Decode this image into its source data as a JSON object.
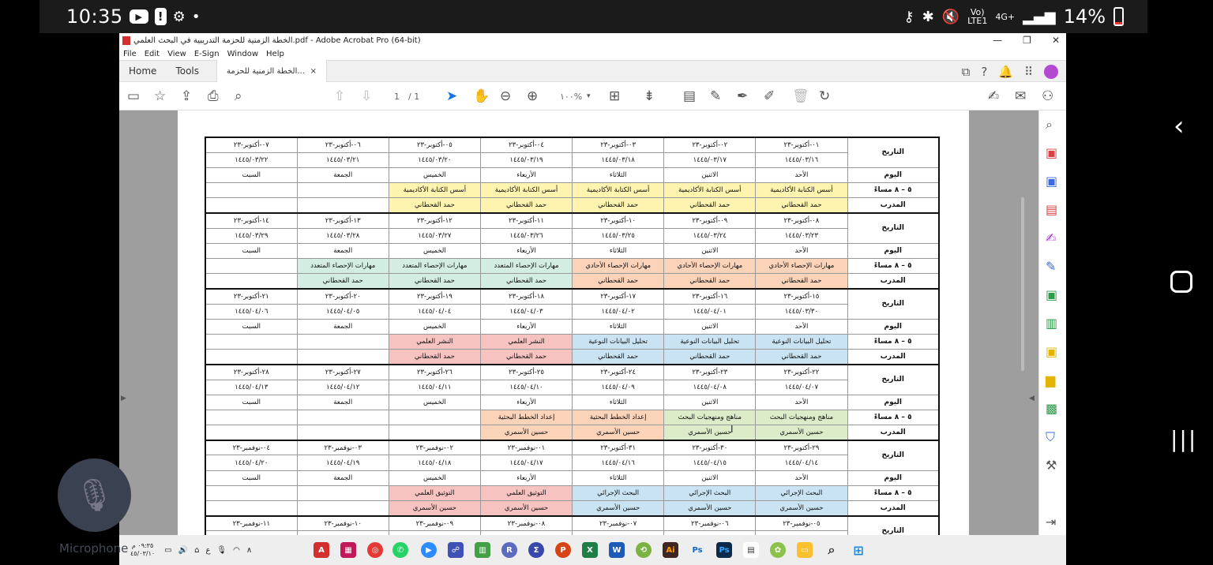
{
  "status_bar": {
    "time": "10:35",
    "net_top": "Vo)",
    "net_bottom": "LTE1",
    "net_type": "4G+",
    "battery_text": "14%",
    "battery_level": 0.14
  },
  "window": {
    "title": "الخطة الزمنية للحزمة التدريبية في البحث العلمي.pdf - Adobe Acrobat Pro (64-bit)"
  },
  "menu": [
    "File",
    "Edit",
    "View",
    "E-Sign",
    "Window",
    "Help"
  ],
  "tabs": {
    "home": "Home",
    "tools": "Tools",
    "doc": "الخطة الزمنية للحزمة...",
    "close": "×"
  },
  "toolbar": {
    "page_current": "1",
    "page_total": "/ 1",
    "zoom": "١٠٠%"
  },
  "schedule": {
    "labels": {
      "date": "التاريخ",
      "day": "اليوم",
      "time": "٥ – ٨ مساءً",
      "trainer": "المدرب"
    },
    "days": [
      "الأحد",
      "الاثنين",
      "الثلاثاء",
      "الأربعاء",
      "الخميس",
      "الجمعة",
      "السبت"
    ],
    "weeks": [
      {
        "greg": [
          "٠١-أكتوبر-٢٣",
          "٠٢-أكتوبر-٢٣",
          "٠٣-أكتوبر-٢٣",
          "٠٤-أكتوبر-٢٣",
          "٠٥-أكتوبر-٢٣",
          "٠٦-أكتوبر-٢٣",
          "٠٧-أكتوبر-٢٣"
        ],
        "hijri": [
          "١٤٤٥/٠٣/١٦",
          "١٤٤٥/٠٣/١٧",
          "١٤٤٥/٠٣/١٨",
          "١٤٤٥/٠٣/١٩",
          "١٤٤٥/٠٣/٢٠",
          "١٤٤٥/٠٣/٢١",
          "١٤٤٥/٠٣/٢٢"
        ],
        "topic": [
          "أسس الكتابة الأكاديمية",
          "أسس الكتابة الأكاديمية",
          "أسس الكتابة الأكاديمية",
          "أسس الكتابة الأكاديمية",
          "أسس الكتابة الأكاديمية",
          "",
          ""
        ],
        "trainer": [
          "حمد القحطاني",
          "حمد القحطاني",
          "حمد القحطاني",
          "حمد القحطاني",
          "حمد القحطاني",
          "",
          ""
        ],
        "colors": [
          "y",
          "y",
          "y",
          "y",
          "y",
          "",
          ""
        ]
      },
      {
        "greg": [
          "٠٨-أكتوبر-٢٣",
          "٠٩-أكتوبر-٢٣",
          "١٠-أكتوبر-٢٣",
          "١١-أكتوبر-٢٣",
          "١٢-أكتوبر-٢٣",
          "١٣-أكتوبر-٢٣",
          "١٤-أكتوبر-٢٣"
        ],
        "hijri": [
          "١٤٤٥/٠٣/٢٣",
          "١٤٤٥/٠٣/٢٤",
          "١٤٤٥/٠٣/٢٥",
          "١٤٤٥/٠٣/٢٦",
          "١٤٤٥/٠٣/٢٧",
          "١٤٤٥/٠٣/٢٨",
          "١٤٤٥/٠٣/٢٩"
        ],
        "topic": [
          "مهارات الإحصاء الأحادي",
          "مهارات الإحصاء الأحادي",
          "مهارات الإحصاء الأحادي",
          "مهارات الإحصاء المتعدد",
          "مهارات الإحصاء المتعدد",
          "مهارات الإحصاء المتعدد",
          ""
        ],
        "trainer": [
          "حمد القحطاني",
          "حمد القحطاني",
          "حمد القحطاني",
          "حمد القحطاني",
          "حمد القحطاني",
          "حمد القحطاني",
          ""
        ],
        "colors": [
          "o",
          "o",
          "o",
          "t",
          "t",
          "t",
          ""
        ]
      },
      {
        "greg": [
          "١٥-أكتوبر-٢٣",
          "١٦-أكتوبر-٢٣",
          "١٧-أكتوبر-٢٣",
          "١٨-أكتوبر-٢٣",
          "١٩-أكتوبر-٢٣",
          "٢٠-أكتوبر-٢٣",
          "٢١-أكتوبر-٢٣"
        ],
        "hijri": [
          "١٤٤٥/٠٣/٣٠",
          "١٤٤٥/٠٤/٠١",
          "١٤٤٥/٠٤/٠٢",
          "١٤٤٥/٠٤/٠٣",
          "١٤٤٥/٠٤/٠٤",
          "١٤٤٥/٠٤/٠٥",
          "١٤٤٥/٠٤/٠٦"
        ],
        "topic": [
          "تحليل البيانات النوعية",
          "تحليل البيانات النوعية",
          "تحليل البيانات النوعية",
          "النشر العلمي",
          "النشر العلمي",
          "",
          ""
        ],
        "trainer": [
          "حمد القحطاني",
          "حمد القحطاني",
          "حمد القحطاني",
          "حمد القحطاني",
          "حمد القحطاني",
          "",
          ""
        ],
        "colors": [
          "b",
          "b",
          "b",
          "r",
          "r",
          "",
          ""
        ]
      },
      {
        "greg": [
          "٢٢-أكتوبر-٢٣",
          "٢٣-أكتوبر-٢٣",
          "٢٤-أكتوبر-٢٣",
          "٢٥-أكتوبر-٢٣",
          "٢٦-أكتوبر-٢٣",
          "٢٧-أكتوبر-٢٣",
          "٢٨-أكتوبر-٢٣"
        ],
        "hijri": [
          "١٤٤٥/٠٤/٠٧",
          "١٤٤٥/٠٤/٠٨",
          "١٤٤٥/٠٤/٠٩",
          "١٤٤٥/٠٤/١٠",
          "١٤٤٥/٠٤/١١",
          "١٤٤٥/٠٤/١٢",
          "١٤٤٥/٠٤/١٣"
        ],
        "topic": [
          "مناهج ومنهجيات البحث",
          "مناهج ومنهجيات البحث",
          "إعداد الخطط البحثية",
          "إعداد الخطط البحثية",
          "",
          "",
          ""
        ],
        "trainer": [
          "حسين الأسمري",
          "حسين الأسمري",
          "حسين الأسمري",
          "حسين الأسمري",
          "",
          "",
          ""
        ],
        "colors": [
          "g",
          "g",
          "o",
          "o",
          "",
          "",
          ""
        ]
      },
      {
        "greg": [
          "٢٩-أكتوبر-٢٣",
          "٣٠-أكتوبر-٢٣",
          "٣١-أكتوبر-٢٣",
          "٠١-نوفمبر-٢٣",
          "٠٢-نوفمبر-٢٣",
          "٠٣-نوفمبر-٢٣",
          "٠٤-نوفمبر-٢٣"
        ],
        "hijri": [
          "١٤٤٥/٠٤/١٤",
          "١٤٤٥/٠٤/١٥",
          "١٤٤٥/٠٤/١٦",
          "١٤٤٥/٠٤/١٧",
          "١٤٤٥/٠٤/١٨",
          "١٤٤٥/٠٤/١٩",
          "١٤٤٥/٠٤/٢٠"
        ],
        "topic": [
          "البحث الإجرائي",
          "البحث الإجرائي",
          "البحث الإجرائي",
          "التوثيق العلمي",
          "التوثيق العلمي",
          "",
          ""
        ],
        "trainer": [
          "حسين الأسمري",
          "حسين الأسمري",
          "حسين الأسمري",
          "حسين الأسمري",
          "حسين الأسمري",
          "",
          ""
        ],
        "colors": [
          "b",
          "b",
          "b",
          "r",
          "r",
          "",
          ""
        ]
      },
      {
        "greg": [
          "٠٥-نوفمبر-٢٣",
          "٠٦-نوفمبر-٢٣",
          "٠٧-نوفمبر-٢٣",
          "٠٨-نوفمبر-٢٣",
          "٠٩-نوفمبر-٢٣",
          "١٠-نوفمبر-٢٣",
          "١١-نوفمبر-٢٣"
        ],
        "hijri": [],
        "topic": [],
        "trainer": [],
        "colors": []
      }
    ]
  },
  "taskbar": {
    "clock_time": "٠٩:٣٥ م",
    "clock_date": "٤٥/٠٣/١٠",
    "lang": "ع"
  },
  "mic_label": "Microphone",
  "colors": {
    "y": "#fff3b0",
    "g": "#dcecc8",
    "o": "#fbd3b8",
    "t": "#d3ede2",
    "b": "#c9e3f3",
    "r": "#f6c3c0"
  }
}
